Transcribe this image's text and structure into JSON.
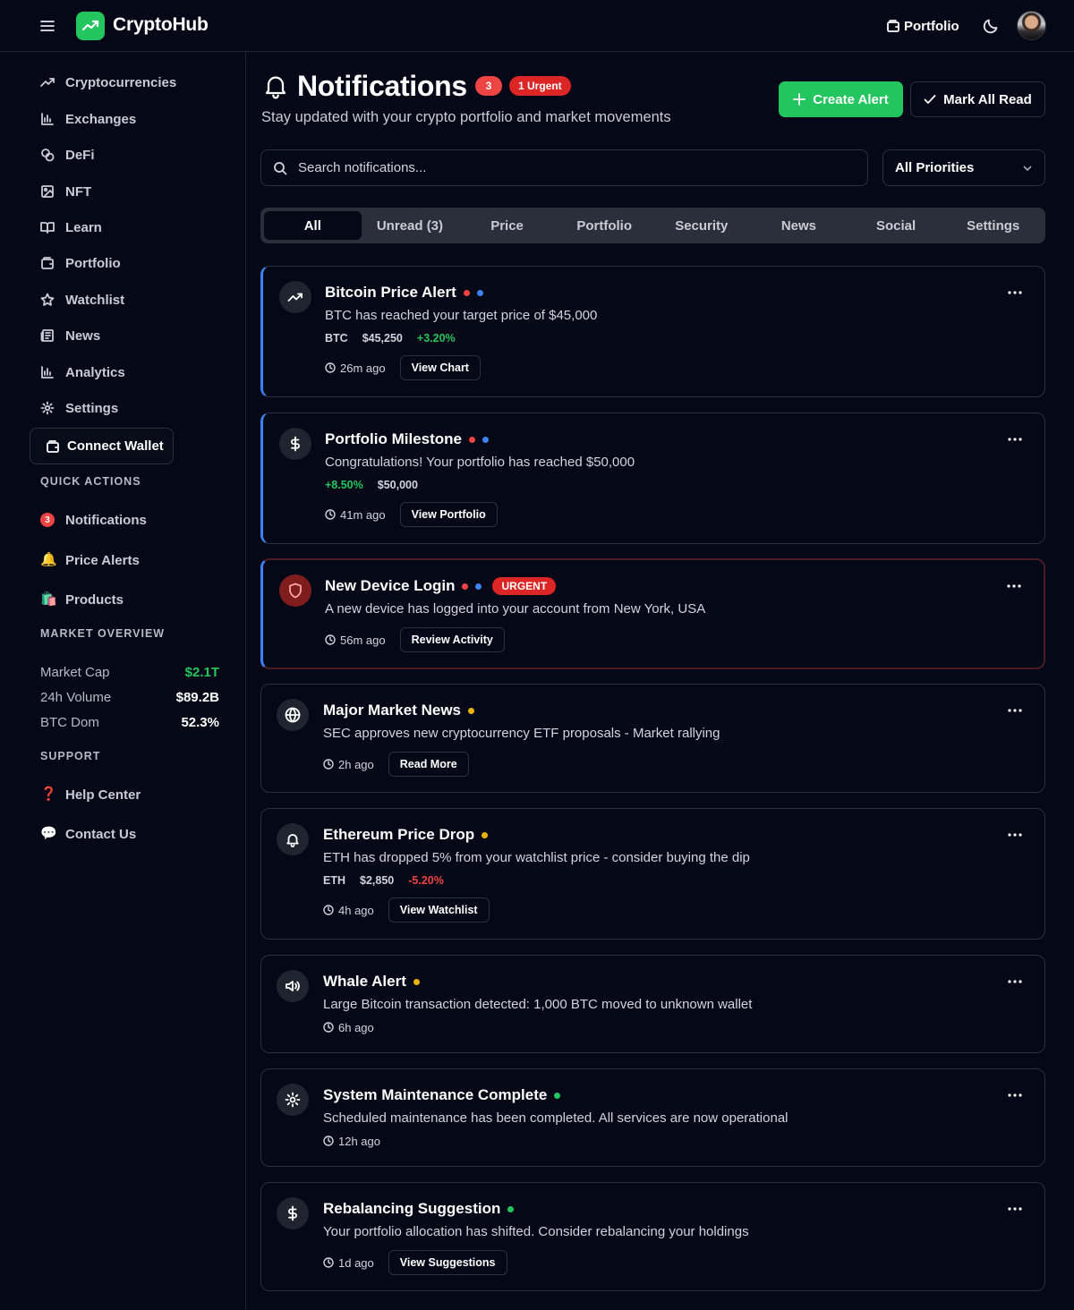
{
  "brand": {
    "name": "CryptoHub"
  },
  "topbar": {
    "portfolio_label": "Portfolio"
  },
  "sidebar": {
    "nav": [
      {
        "label": "Cryptocurrencies",
        "icon": "trending-icon"
      },
      {
        "label": "Exchanges",
        "icon": "bar-chart-icon"
      },
      {
        "label": "DeFi",
        "icon": "coins-icon"
      },
      {
        "label": "NFT",
        "icon": "image-icon"
      },
      {
        "label": "Learn",
        "icon": "book-icon"
      },
      {
        "label": "Portfolio",
        "icon": "wallet-icon"
      },
      {
        "label": "Watchlist",
        "icon": "star-icon"
      },
      {
        "label": "News",
        "icon": "newspaper-icon"
      },
      {
        "label": "Analytics",
        "icon": "bar-chart-icon"
      },
      {
        "label": "Settings",
        "icon": "gear-icon"
      }
    ],
    "connect_wallet": "Connect Wallet",
    "quick_actions_title": "QUICK ACTIONS",
    "quick_actions": [
      {
        "label": "Notifications",
        "badge": "3"
      },
      {
        "label": "Price Alerts",
        "emoji": "🔔"
      },
      {
        "label": "Products",
        "emoji": "🛍️"
      }
    ],
    "market_overview_title": "MARKET OVERVIEW",
    "market_overview": [
      {
        "label": "Market Cap",
        "value": "$2.1T",
        "color": "#22c55e"
      },
      {
        "label": "24h Volume",
        "value": "$89.2B",
        "color": "#ffffff"
      },
      {
        "label": "BTC Dom",
        "value": "52.3%",
        "color": "#ffffff"
      }
    ],
    "support_title": "SUPPORT",
    "support": [
      {
        "label": "Help Center",
        "emoji": "❓"
      },
      {
        "label": "Contact Us",
        "emoji": "💬"
      }
    ]
  },
  "header": {
    "title": "Notifications",
    "count_badge": "3",
    "urgent_badge": "1 Urgent",
    "subtitle": "Stay updated with your crypto portfolio and market movements",
    "create_alert": "Create Alert",
    "mark_all_read": "Mark All Read"
  },
  "filters": {
    "search_placeholder": "Search notifications...",
    "priority_selected": "All Priorities"
  },
  "tabs": [
    "All",
    "Unread (3)",
    "Price",
    "Portfolio",
    "Security",
    "News",
    "Social",
    "Settings"
  ],
  "active_tab": "All",
  "notifications": [
    {
      "title": "Bitcoin Price Alert",
      "message": "BTC has reached your target price of $45,000",
      "meta": [
        "BTC",
        "$45,250",
        "+3.20%"
      ],
      "time": "26m ago",
      "action": "View Chart",
      "icon": "trending-up-icon"
    },
    {
      "title": "Portfolio Milestone",
      "message": "Congratulations! Your portfolio has reached $50,000",
      "meta": [
        "+8.50%",
        "$50,000"
      ],
      "time": "41m ago",
      "action": "View Portfolio",
      "icon": "dollar-icon"
    },
    {
      "title": "New Device Login",
      "tag": "URGENT",
      "message": "A new device has logged into your account from New York, USA",
      "time": "56m ago",
      "action": "Review Activity",
      "icon": "shield-icon"
    },
    {
      "title": "Major Market News",
      "message": "SEC approves new cryptocurrency ETF proposals - Market rallying",
      "time": "2h ago",
      "action": "Read More",
      "icon": "globe-icon"
    },
    {
      "title": "Ethereum Price Drop",
      "message": "ETH has dropped 5% from your watchlist price - consider buying the dip",
      "meta": [
        "ETH",
        "$2,850",
        "-5.20%"
      ],
      "time": "4h ago",
      "action": "View Watchlist",
      "icon": "bell-icon"
    },
    {
      "title": "Whale Alert",
      "message": "Large Bitcoin transaction detected: 1,000 BTC moved to unknown wallet",
      "time": "6h ago",
      "icon": "speaker-icon"
    },
    {
      "title": "System Maintenance Complete",
      "message": "Scheduled maintenance has been completed. All services are now operational",
      "time": "12h ago",
      "icon": "gear-icon"
    },
    {
      "title": "Rebalancing Suggestion",
      "message": "Your portfolio allocation has shifted. Consider rebalancing your holdings",
      "time": "1d ago",
      "action": "View Suggestions",
      "icon": "dollar-icon"
    }
  ],
  "colors": {
    "accent": "#22c55e",
    "urgent": "#dc2626",
    "unread": "#3b82f6",
    "background": "#050816"
  }
}
